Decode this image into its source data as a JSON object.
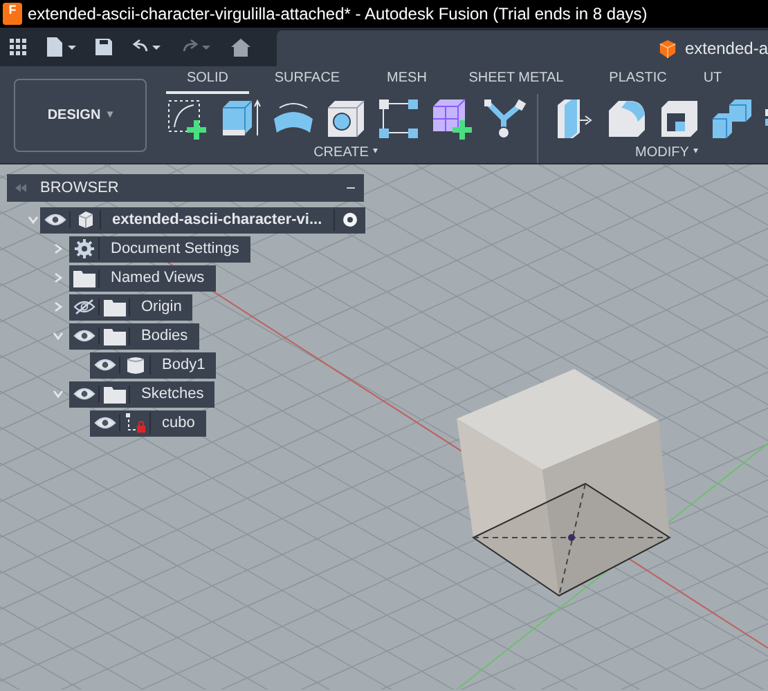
{
  "window": {
    "title": "extended-ascii-character-virgulilla-attached* - Autodesk Fusion (Trial ends in 8 days)",
    "app_icon_letter": "F"
  },
  "document_tab": {
    "label": "extended-a"
  },
  "workspace": {
    "label": "DESIGN",
    "caret": "▾"
  },
  "toolbar_tabs": [
    {
      "label": "SOLID",
      "selected": true
    },
    {
      "label": "SURFACE",
      "selected": false
    },
    {
      "label": "MESH",
      "selected": false
    },
    {
      "label": "SHEET METAL",
      "selected": false
    },
    {
      "label": "PLASTIC",
      "selected": false
    },
    {
      "label": "UT",
      "selected": false
    }
  ],
  "tool_groups": [
    {
      "label": "CREATE",
      "caret": "▾"
    },
    {
      "label": "MODIFY",
      "caret": "▾"
    }
  ],
  "browser": {
    "title": "BROWSER",
    "collapse": "−",
    "root": {
      "label": "extended-ascii-character-vi...",
      "expanded": true,
      "visible": true,
      "kind": "component",
      "children": [
        {
          "label": "Document Settings",
          "expanded": false,
          "kind": "gear"
        },
        {
          "label": "Named Views",
          "expanded": false,
          "kind": "folder"
        },
        {
          "label": "Origin",
          "expanded": false,
          "visible": false,
          "kind": "folder"
        },
        {
          "label": "Bodies",
          "expanded": true,
          "visible": true,
          "kind": "folder",
          "children": [
            {
              "label": "Body1",
              "visible": true,
              "kind": "body"
            }
          ]
        },
        {
          "label": "Sketches",
          "expanded": true,
          "visible": true,
          "kind": "folder",
          "children": [
            {
              "label": "cubo",
              "visible": true,
              "kind": "sketch"
            }
          ]
        }
      ]
    }
  }
}
